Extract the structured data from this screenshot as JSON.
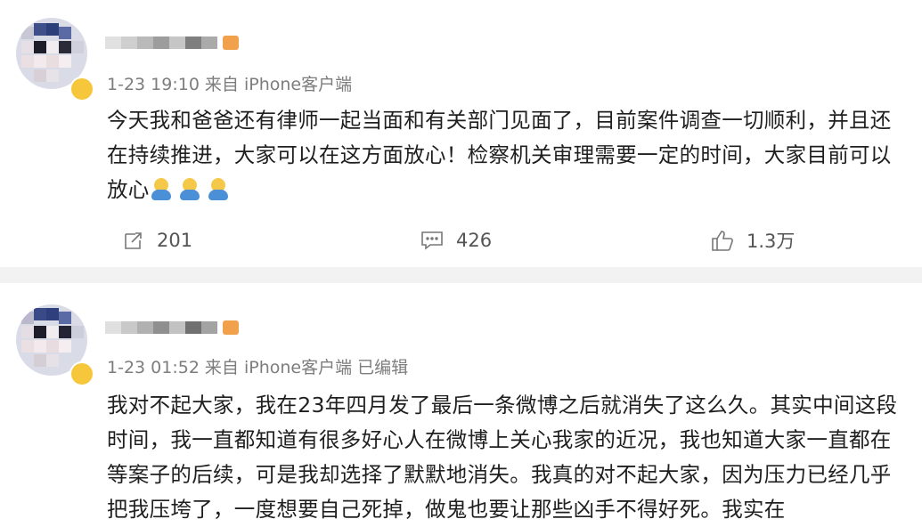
{
  "posts": [
    {
      "time": "1-23 19:10",
      "source": "来自 iPhone客户端",
      "edited": "",
      "text": "今天我和爸爸还有律师一起当面和有关部门见面了，目前案件调查一切顺利，并且还在持续推进，大家可以在这方面放心！检察机关审理需要一定的时间，大家目前可以放心",
      "emoji_count": 3,
      "reposts": "201",
      "comments": "426",
      "likes": "1.3万"
    },
    {
      "time": "1-23 01:52",
      "source": "来自 iPhone客户端",
      "edited": "已编辑",
      "text": "我对不起大家，我在23年四月发了最后一条微博之后就消失了这么久。其实中间这段时间，我一直都知道有很多好心人在微博上关心我家的近况，我也知道大家一直都在等案子的后续，可是我却选择了默默地消失。我真的对不起大家，因为压力已经几乎把我压垮了，一度想要自己死掉，做鬼也要让那些凶手不得好死。我实在"
    }
  ],
  "icons": [
    "repost-icon",
    "comment-icon",
    "like-icon"
  ],
  "colors": {
    "meta": "#7d7d7d",
    "separator": "#f2f2f2",
    "vip_badge": "#f6c63b"
  }
}
